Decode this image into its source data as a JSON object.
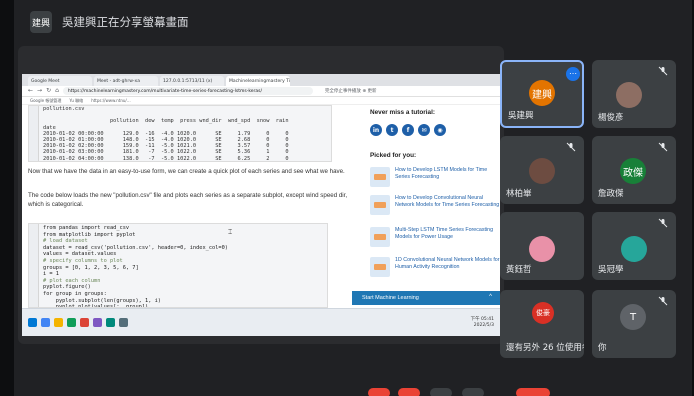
{
  "meeting": {
    "presenter_chip": "建興",
    "title": "吳建興正在分享螢幕畫面"
  },
  "browser": {
    "tabs": [
      "Google Meet",
      "Meet - adt-ghrw-xa",
      "127.0.0.1:5713/11 (x)",
      "Machinelearningmastery Time Series Fo..."
    ],
    "nav_glyphs": [
      "←",
      "→",
      "↻",
      "⌂"
    ],
    "url": "https://machinelearningmastery.com/multivariate-time-series-forecasting-lstms-keras/",
    "url_right": "完全停止事件播放   ⊕ 更新",
    "bookmarks": [
      "Google 帳號管理",
      "Yu 聯絡",
      "https://www.ntnu/…"
    ]
  },
  "article": {
    "output_title": "pollution.csv",
    "output_lines": [
      "                     pollution  dew  temp  press wnd_dir  wnd_spd  snow  rain",
      "date",
      "2010-01-02 00:00:00      129.0  -16  -4.0 1020.0      SE     1.79     0     0",
      "2010-01-02 01:00:00      148.0  -15  -4.0 1020.0      SE     2.68     0     0",
      "2010-01-02 02:00:00      159.0  -11  -5.0 1021.0      SE     3.57     0     0",
      "2010-01-02 03:00:00      181.0   -7  -5.0 1022.0      SE     5.36     1     0",
      "2010-01-02 04:00:00      138.0   -7  -5.0 1022.0      SE     6.25     2     0"
    ],
    "para1": "Now that we have the data in an easy-to-use form, we can create a quick plot of each series and see what we have.",
    "para2": "The code below loads the new \"pollution.csv\" file and plots each series as a separate subplot, except wind speed dir, which is categorical.",
    "code_lines": [
      "from pandas import read_csv",
      "from matplotlib import pyplot",
      "# load dataset",
      "dataset = read_csv('pollution.csv', header=0, index_col=0)",
      "values = dataset.values",
      "# specify columns to plot",
      "groups = [0, 1, 2, 3, 5, 6, 7]",
      "i = 1",
      "# plot each column",
      "pyplot.figure()",
      "for group in groups:",
      "    pyplot.subplot(len(groups), 1, i)",
      "    pyplot.plot(values[:, group])",
      "    pyplot.title(dataset.columns[group], y=0.5, loc='right')",
      "    i += 1"
    ]
  },
  "sidebar": {
    "never_miss": "Never miss a tutorial:",
    "socials": [
      "in",
      "t",
      "f",
      "✉",
      "◉"
    ],
    "picked": "Picked for you:",
    "recommendations": [
      "How to Develop LSTM Models for Time Series Forecasting",
      "How to Develop Convolutional Neural Network Models for Time Series Forecasting",
      "Multi-Step LSTM Time Series Forecasting Models for Power Usage",
      "1D Convolutional Neural Network Models for Human Activity Recognition"
    ],
    "banner": "Start Machine Learning",
    "banner_chevron": "^"
  },
  "taskbar": {
    "clock": "下午 05:41",
    "date": "2022/5/3"
  },
  "participants": [
    {
      "name": "吳建興",
      "initials": "建興",
      "color": "#e37400",
      "active": true,
      "muted": false
    },
    {
      "name": "楊俊彥",
      "initials": "",
      "color": "#8d6e63",
      "active": false,
      "muted": true
    },
    {
      "name": "林柏崋",
      "initials": "",
      "color": "#6d4c41",
      "active": false,
      "muted": true
    },
    {
      "name": "詹政傑",
      "initials": "政傑",
      "color": "#188038",
      "active": false,
      "muted": true
    },
    {
      "name": "黃鈺哲",
      "initials": "",
      "color": "#e991a8",
      "active": false,
      "muted": false
    },
    {
      "name": "吳冠學",
      "initials": "",
      "color": "#26a69a",
      "active": false,
      "muted": true
    },
    {
      "name": "還有另外 26 位使用者",
      "initials": "俊豪",
      "color": "#d93025",
      "active": false,
      "muted": false
    },
    {
      "name": "你",
      "initials": "T",
      "color": "#5f6368",
      "active": false,
      "muted": true
    }
  ],
  "colors": {
    "meet_bg": "#202124",
    "tile_bg": "#3c4043",
    "active_border": "#8ab4f8",
    "banner_blue": "#1f77b4",
    "link_blue": "#1e5fa8"
  }
}
